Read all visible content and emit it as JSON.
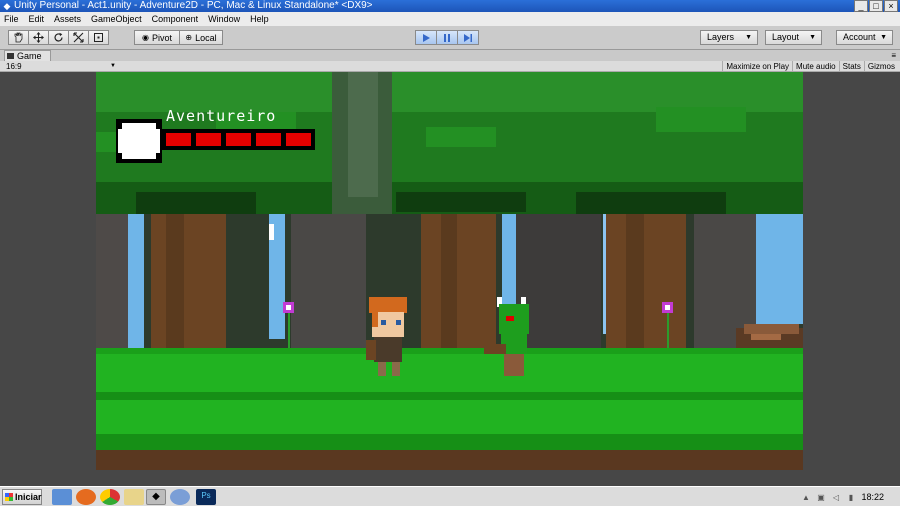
{
  "window": {
    "title": "Unity Personal - Act1.unity - Adventure2D - PC, Mac & Linux Standalone* <DX9>",
    "buttons": [
      "_",
      "□",
      "×"
    ]
  },
  "menu": [
    "File",
    "Edit",
    "Assets",
    "GameObject",
    "Component",
    "Window",
    "Help"
  ],
  "toolbar": {
    "pivot_label": "Pivot",
    "local_label": "Local",
    "layers_label": "Layers",
    "layout_label": "Layout",
    "account_label": "Account"
  },
  "game_tab": {
    "title": "Game",
    "aspect": "16:9",
    "options": [
      "Maximize on Play",
      "Mute audio",
      "Stats",
      "Gizmos"
    ]
  },
  "hud": {
    "player_name": "Aventureiro",
    "health_segments": 5,
    "health_filled": 5,
    "health_color": "#e60000"
  },
  "colors": {
    "grass": "#21b321",
    "foliage": "#1f7a1f",
    "trunk": "#6b4423",
    "sky": "#6fb5e8"
  },
  "taskbar": {
    "start_label": "Iniciar",
    "clock": "18:22"
  }
}
